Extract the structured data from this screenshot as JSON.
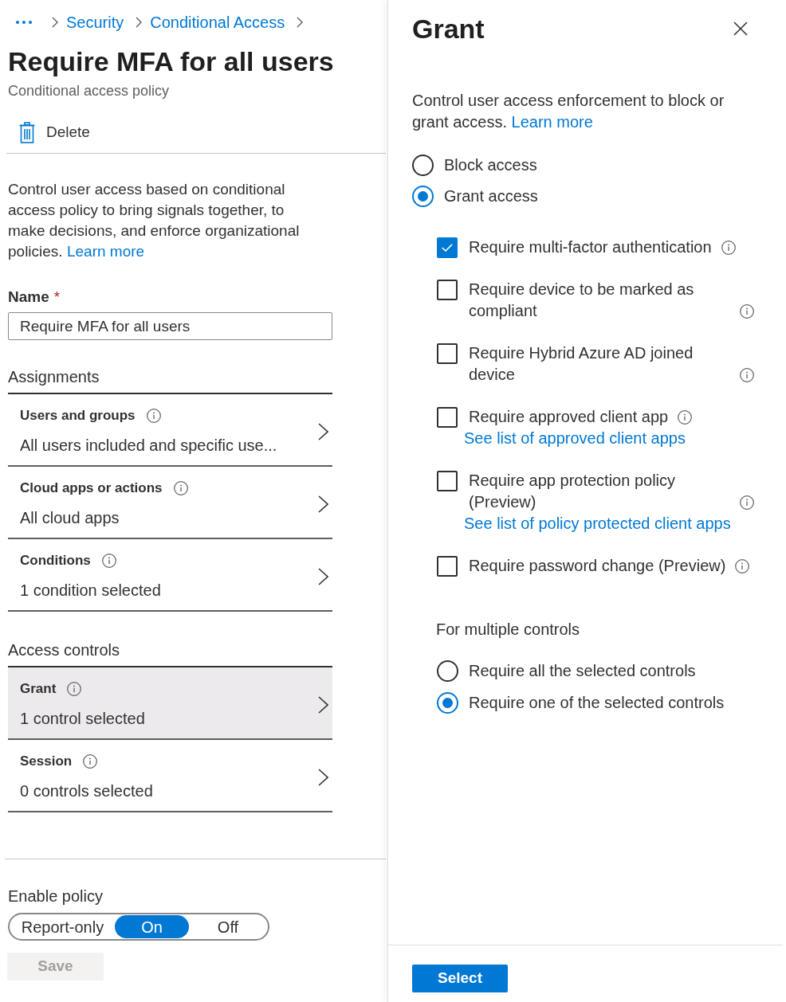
{
  "breadcrumb": [
    {
      "label": "Security"
    },
    {
      "label": "Conditional Access"
    }
  ],
  "header": {
    "title": "Require MFA for all users",
    "subtitle": "Conditional access policy"
  },
  "delete_button": {
    "label": "Delete"
  },
  "description": {
    "text": "Control user access based on conditional access policy to bring signals together, to make decisions, and enforce organizational policies.",
    "link": "Learn more"
  },
  "name_field": {
    "label": "Name",
    "required_mark": "*",
    "value": "Require MFA for all users"
  },
  "sections": [
    {
      "heading": "Assignments",
      "items": [
        {
          "title": "Users and groups",
          "summary": "All users included and specific use...",
          "selected": false
        },
        {
          "title": "Cloud apps or actions",
          "summary": "All cloud apps",
          "selected": false
        },
        {
          "title": "Conditions",
          "summary": "1 condition selected",
          "selected": false
        }
      ]
    },
    {
      "heading": "Access controls",
      "items": [
        {
          "title": "Grant",
          "summary": "1 control selected",
          "selected": true
        },
        {
          "title": "Session",
          "summary": "0 controls selected",
          "selected": false
        }
      ]
    }
  ],
  "enable_policy": {
    "label": "Enable policy",
    "options": [
      {
        "label": "Report-only",
        "selected": false
      },
      {
        "label": "On",
        "selected": true
      },
      {
        "label": "Off",
        "selected": false
      }
    ]
  },
  "save_button": {
    "label": "Save",
    "disabled": true
  },
  "grant_panel": {
    "title": "Grant",
    "description": {
      "text": "Control user access enforcement to block or grant access.",
      "link": "Learn more"
    },
    "access_options": [
      {
        "label": "Block access",
        "selected": false
      },
      {
        "label": "Grant access",
        "selected": true
      }
    ],
    "controls": [
      {
        "label": "Require multi-factor authentication",
        "checked": true
      },
      {
        "label": "Require device to be marked as compliant",
        "checked": false
      },
      {
        "label": "Require Hybrid Azure AD joined device",
        "checked": false
      },
      {
        "label": "Require approved client app",
        "checked": false,
        "link": "See list of approved client apps"
      },
      {
        "label": "Require app protection policy (Preview)",
        "checked": false,
        "link": "See list of policy protected client apps"
      },
      {
        "label": "Require password change (Preview)",
        "checked": false
      }
    ],
    "multiple_controls": {
      "label": "For multiple controls",
      "options": [
        {
          "label": "Require all the selected controls",
          "selected": false
        },
        {
          "label": "Require one of the selected controls",
          "selected": true
        }
      ]
    },
    "select_button": {
      "label": "Select"
    }
  }
}
